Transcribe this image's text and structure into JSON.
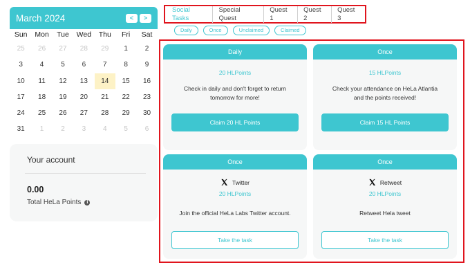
{
  "calendar": {
    "title": "March 2024",
    "prev": "<",
    "next": ">",
    "weekdays": [
      "Sun",
      "Mon",
      "Tue",
      "Wed",
      "Thu",
      "Fri",
      "Sat"
    ],
    "days": [
      {
        "d": "25",
        "m": true
      },
      {
        "d": "26",
        "m": true
      },
      {
        "d": "27",
        "m": true
      },
      {
        "d": "28",
        "m": true
      },
      {
        "d": "29",
        "m": true
      },
      {
        "d": "1"
      },
      {
        "d": "2"
      },
      {
        "d": "3"
      },
      {
        "d": "4"
      },
      {
        "d": "5"
      },
      {
        "d": "6"
      },
      {
        "d": "7"
      },
      {
        "d": "8"
      },
      {
        "d": "9"
      },
      {
        "d": "10"
      },
      {
        "d": "11"
      },
      {
        "d": "12"
      },
      {
        "d": "13"
      },
      {
        "d": "14",
        "today": true
      },
      {
        "d": "15"
      },
      {
        "d": "16"
      },
      {
        "d": "17"
      },
      {
        "d": "18"
      },
      {
        "d": "19"
      },
      {
        "d": "20"
      },
      {
        "d": "21"
      },
      {
        "d": "22"
      },
      {
        "d": "23"
      },
      {
        "d": "24"
      },
      {
        "d": "25"
      },
      {
        "d": "26"
      },
      {
        "d": "27"
      },
      {
        "d": "28"
      },
      {
        "d": "29"
      },
      {
        "d": "30"
      },
      {
        "d": "31"
      },
      {
        "d": "1",
        "m": true
      },
      {
        "d": "2",
        "m": true
      },
      {
        "d": "3",
        "m": true
      },
      {
        "d": "4",
        "m": true
      },
      {
        "d": "5",
        "m": true
      },
      {
        "d": "6",
        "m": true
      }
    ]
  },
  "account": {
    "title": "Your account",
    "value": "0.00",
    "label": "Total HeLa Points",
    "info_icon": "i"
  },
  "tabs": [
    {
      "label": "Social Tasks",
      "active": true
    },
    {
      "label": "Special Quest"
    },
    {
      "label": "Quest 1"
    },
    {
      "label": "Quest 2"
    },
    {
      "label": "Quest 3"
    }
  ],
  "filters": [
    "Daily",
    "Once",
    "Unclaimed",
    "Claimed"
  ],
  "cards": [
    {
      "header": "Daily",
      "points": "20 HLPoints",
      "desc": "Check in daily and don't forget to return tomorrow for more!",
      "button": "Claim 20 HL Points"
    },
    {
      "header": "Once",
      "points": "15 HLPoints",
      "desc": "Check your attendance on HeLa Atlantia and the points received!",
      "button": "Claim 15 HL Points"
    },
    {
      "header": "Once",
      "social": "Twitter",
      "points": "20 HLPoints",
      "desc": "Join the official HeLa Labs Twitter account.",
      "button": "Take the task"
    },
    {
      "header": "Once",
      "social": "Retweet",
      "points": "20 HLPoints",
      "desc": "Retweet Hela tweet",
      "button": "Take the task"
    }
  ],
  "colors": {
    "accent": "#3ec6d0",
    "highlight": "#e0141d",
    "today": "#fdf2c6"
  },
  "icons": {
    "social": "x-logo-icon",
    "prev": "chevron-left-icon",
    "next": "chevron-right-icon"
  }
}
